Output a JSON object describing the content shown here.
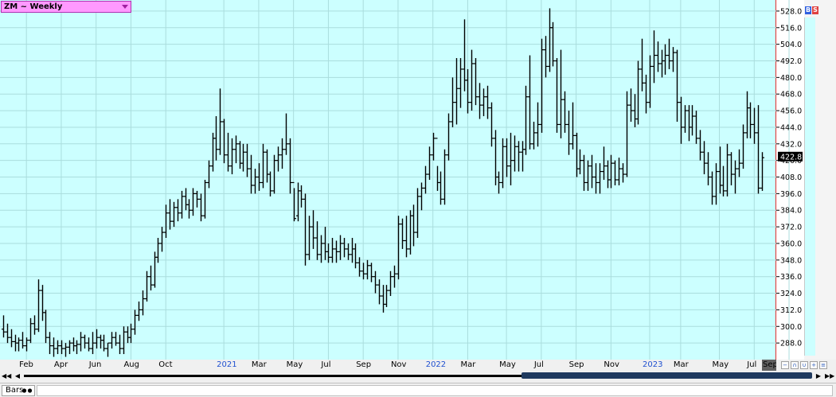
{
  "window": {
    "title": "ZM ~ Weekly",
    "bottom_tab": "Bars",
    "badges": [
      {
        "label": "B",
        "color": "#3060e0"
      },
      {
        "label": "S",
        "color": "#e04040"
      }
    ],
    "sep_label": "Sep"
  },
  "colors": {
    "plot_background": "#ccffff",
    "grid": "#aadddd",
    "bars": "#000000",
    "border": "#e03030",
    "year_label": "#2050d0",
    "title_background": "#ff99ff",
    "last_price_box": "#000000"
  },
  "chart_data": {
    "type": "ohlc",
    "title": "ZM ~ Weekly",
    "timeframe": "Weekly",
    "ylim": [
      276,
      536
    ],
    "y_ticks": [
      528,
      516,
      504,
      492,
      480,
      468,
      456,
      444,
      432,
      420,
      408,
      396,
      384,
      372,
      360,
      348,
      336,
      324,
      312,
      300,
      288
    ],
    "y_tick_labels": [
      "528.0",
      "516.0",
      "504.0",
      "492.0",
      "480.0",
      "468.0",
      "456.0",
      "444.0",
      "432.0",
      "420.0",
      "408.0",
      "396.0",
      "384.0",
      "372.0",
      "360.0",
      "348.0",
      "336.0",
      "324.0",
      "312.0",
      "300.0",
      "288.0"
    ],
    "last_price": 422.8,
    "last_price_label": "422.8",
    "x_labels": [
      {
        "label": "Feb",
        "bar": 6,
        "year": false
      },
      {
        "label": "Apr",
        "bar": 15,
        "year": false
      },
      {
        "label": "Jun",
        "bar": 24,
        "year": false
      },
      {
        "label": "Aug",
        "bar": 33,
        "year": false
      },
      {
        "label": "Oct",
        "bar": 42,
        "year": false
      },
      {
        "label": "2021",
        "bar": 57,
        "year": true
      },
      {
        "label": "Mar",
        "bar": 66,
        "year": false
      },
      {
        "label": "May",
        "bar": 75,
        "year": false
      },
      {
        "label": "Jul",
        "bar": 84,
        "year": false
      },
      {
        "label": "Sep",
        "bar": 93,
        "year": false
      },
      {
        "label": "Nov",
        "bar": 102,
        "year": false
      },
      {
        "label": "2022",
        "bar": 111,
        "year": true
      },
      {
        "label": "Mar",
        "bar": 120,
        "year": false
      },
      {
        "label": "May",
        "bar": 130,
        "year": false
      },
      {
        "label": "Jul",
        "bar": 139,
        "year": false
      },
      {
        "label": "Sep",
        "bar": 148,
        "year": false
      },
      {
        "label": "Nov",
        "bar": 157,
        "year": false
      },
      {
        "label": "2023",
        "bar": 167,
        "year": true
      },
      {
        "label": "Mar",
        "bar": 175,
        "year": false
      },
      {
        "label": "May",
        "bar": 185,
        "year": false
      },
      {
        "label": "Jul",
        "bar": 194,
        "year": false
      },
      {
        "label": "Sep",
        "bar": 203,
        "year": false
      }
    ],
    "ohlc": [
      [
        298,
        308,
        292,
        296
      ],
      [
        296,
        302,
        288,
        292
      ],
      [
        292,
        298,
        285,
        289
      ],
      [
        289,
        294,
        282,
        288
      ],
      [
        288,
        292,
        282,
        290
      ],
      [
        290,
        296,
        284,
        286
      ],
      [
        286,
        292,
        282,
        290
      ],
      [
        290,
        306,
        288,
        302
      ],
      [
        302,
        308,
        294,
        298
      ],
      [
        298,
        334,
        296,
        326
      ],
      [
        326,
        330,
        304,
        310
      ],
      [
        310,
        312,
        288,
        292
      ],
      [
        292,
        296,
        280,
        286
      ],
      [
        286,
        292,
        278,
        284
      ],
      [
        284,
        290,
        280,
        286
      ],
      [
        286,
        290,
        280,
        284
      ],
      [
        284,
        288,
        278,
        285
      ],
      [
        285,
        290,
        280,
        288
      ],
      [
        288,
        292,
        282,
        286
      ],
      [
        286,
        290,
        280,
        287
      ],
      [
        287,
        296,
        282,
        292
      ],
      [
        292,
        294,
        284,
        288
      ],
      [
        288,
        292,
        282,
        284
      ],
      [
        284,
        296,
        280,
        288
      ],
      [
        288,
        298,
        284,
        292
      ],
      [
        292,
        294,
        284,
        290
      ],
      [
        290,
        294,
        282,
        284
      ],
      [
        284,
        288,
        278,
        288
      ],
      [
        288,
        296,
        284,
        292
      ],
      [
        292,
        296,
        286,
        288
      ],
      [
        288,
        294,
        280,
        284
      ],
      [
        284,
        300,
        280,
        296
      ],
      [
        296,
        300,
        288,
        292
      ],
      [
        292,
        302,
        288,
        298
      ],
      [
        298,
        312,
        294,
        308
      ],
      [
        308,
        318,
        304,
        312
      ],
      [
        312,
        326,
        308,
        320
      ],
      [
        320,
        340,
        318,
        336
      ],
      [
        336,
        344,
        326,
        330
      ],
      [
        330,
        354,
        328,
        350
      ],
      [
        350,
        364,
        346,
        360
      ],
      [
        360,
        372,
        354,
        368
      ],
      [
        368,
        388,
        364,
        382
      ],
      [
        382,
        392,
        370,
        376
      ],
      [
        376,
        390,
        372,
        386
      ],
      [
        386,
        392,
        376,
        382
      ],
      [
        382,
        398,
        378,
        394
      ],
      [
        394,
        400,
        384,
        388
      ],
      [
        388,
        392,
        378,
        384
      ],
      [
        384,
        400,
        380,
        396
      ],
      [
        396,
        398,
        386,
        392
      ],
      [
        392,
        396,
        376,
        380
      ],
      [
        380,
        406,
        378,
        404
      ],
      [
        404,
        420,
        400,
        416
      ],
      [
        416,
        440,
        412,
        436
      ],
      [
        436,
        452,
        420,
        428
      ],
      [
        428,
        472,
        424,
        448
      ],
      [
        448,
        450,
        418,
        424
      ],
      [
        424,
        440,
        412,
        416
      ],
      [
        416,
        436,
        410,
        428
      ],
      [
        428,
        438,
        418,
        432
      ],
      [
        432,
        434,
        414,
        418
      ],
      [
        418,
        432,
        412,
        426
      ],
      [
        426,
        432,
        408,
        414
      ],
      [
        414,
        424,
        396,
        402
      ],
      [
        402,
        414,
        396,
        408
      ],
      [
        408,
        418,
        398,
        404
      ],
      [
        404,
        432,
        400,
        426
      ],
      [
        426,
        428,
        404,
        410
      ],
      [
        410,
        412,
        394,
        398
      ],
      [
        398,
        424,
        396,
        420
      ],
      [
        420,
        430,
        412,
        424
      ],
      [
        424,
        436,
        414,
        428
      ],
      [
        428,
        454,
        424,
        432
      ],
      [
        432,
        436,
        396,
        404
      ],
      [
        404,
        400,
        376,
        378
      ],
      [
        380,
        404,
        376,
        398
      ],
      [
        398,
        402,
        386,
        392
      ],
      [
        392,
        396,
        344,
        352
      ],
      [
        352,
        380,
        348,
        372
      ],
      [
        372,
        384,
        356,
        364
      ],
      [
        364,
        376,
        348,
        352
      ],
      [
        352,
        366,
        346,
        360
      ],
      [
        360,
        372,
        348,
        354
      ],
      [
        354,
        360,
        346,
        350
      ],
      [
        350,
        364,
        346,
        356
      ],
      [
        356,
        362,
        346,
        354
      ],
      [
        354,
        366,
        348,
        360
      ],
      [
        360,
        364,
        350,
        356
      ],
      [
        356,
        360,
        348,
        352
      ],
      [
        352,
        364,
        346,
        356
      ],
      [
        356,
        360,
        342,
        346
      ],
      [
        346,
        350,
        336,
        340
      ],
      [
        340,
        346,
        334,
        338
      ],
      [
        338,
        348,
        334,
        344
      ],
      [
        344,
        346,
        332,
        336
      ],
      [
        336,
        340,
        324,
        330
      ],
      [
        330,
        334,
        316,
        322
      ],
      [
        322,
        330,
        310,
        316
      ],
      [
        316,
        330,
        314,
        326
      ],
      [
        326,
        340,
        322,
        336
      ],
      [
        336,
        344,
        328,
        338
      ],
      [
        338,
        380,
        334,
        374
      ],
      [
        374,
        378,
        356,
        362
      ],
      [
        362,
        380,
        350,
        356
      ],
      [
        356,
        384,
        352,
        380
      ],
      [
        380,
        388,
        358,
        368
      ],
      [
        368,
        400,
        364,
        394
      ],
      [
        394,
        404,
        384,
        400
      ],
      [
        400,
        416,
        396,
        410
      ],
      [
        410,
        430,
        406,
        424
      ],
      [
        424,
        440,
        420,
        436
      ],
      [
        436,
        416,
        398,
        404
      ],
      [
        404,
        412,
        388,
        392
      ],
      [
        392,
        428,
        388,
        424
      ],
      [
        424,
        454,
        420,
        448
      ],
      [
        448,
        480,
        444,
        462
      ],
      [
        462,
        494,
        446,
        472
      ],
      [
        472,
        494,
        458,
        486
      ],
      [
        486,
        522,
        470,
        478
      ],
      [
        478,
        486,
        454,
        462
      ],
      [
        462,
        500,
        456,
        490
      ],
      [
        490,
        494,
        460,
        466
      ],
      [
        466,
        476,
        450,
        460
      ],
      [
        460,
        472,
        452,
        466
      ],
      [
        466,
        474,
        450,
        458
      ],
      [
        458,
        462,
        430,
        436
      ],
      [
        436,
        442,
        402,
        408
      ],
      [
        408,
        412,
        396,
        404
      ],
      [
        404,
        436,
        400,
        430
      ],
      [
        430,
        436,
        408,
        416
      ],
      [
        416,
        440,
        402,
        420
      ],
      [
        420,
        438,
        412,
        430
      ],
      [
        430,
        434,
        412,
        426
      ],
      [
        426,
        434,
        412,
        428
      ],
      [
        428,
        474,
        424,
        466
      ],
      [
        466,
        496,
        428,
        432
      ],
      [
        432,
        448,
        428,
        440
      ],
      [
        440,
        462,
        430,
        446
      ],
      [
        446,
        508,
        440,
        500
      ],
      [
        500,
        510,
        480,
        488
      ],
      [
        488,
        530,
        484,
        516
      ],
      [
        516,
        520,
        488,
        492
      ],
      [
        492,
        494,
        440,
        446
      ],
      [
        446,
        500,
        436,
        464
      ],
      [
        464,
        470,
        440,
        446
      ],
      [
        446,
        456,
        424,
        432
      ],
      [
        432,
        462,
        428,
        438
      ],
      [
        438,
        440,
        408,
        414
      ],
      [
        414,
        428,
        410,
        420
      ],
      [
        420,
        424,
        398,
        404
      ],
      [
        404,
        420,
        398,
        416
      ],
      [
        416,
        424,
        400,
        408
      ],
      [
        408,
        418,
        396,
        404
      ],
      [
        404,
        418,
        396,
        412
      ],
      [
        412,
        430,
        406,
        416
      ],
      [
        416,
        420,
        400,
        406
      ],
      [
        406,
        424,
        400,
        418
      ],
      [
        418,
        420,
        402,
        406
      ],
      [
        406,
        422,
        402,
        414
      ],
      [
        414,
        418,
        404,
        410
      ],
      [
        410,
        470,
        408,
        460
      ],
      [
        460,
        472,
        448,
        456
      ],
      [
        456,
        468,
        444,
        450
      ],
      [
        450,
        492,
        446,
        486
      ],
      [
        486,
        508,
        470,
        476
      ],
      [
        476,
        482,
        454,
        462
      ],
      [
        462,
        496,
        458,
        488
      ],
      [
        488,
        514,
        476,
        496
      ],
      [
        496,
        506,
        484,
        490
      ],
      [
        490,
        500,
        480,
        492
      ],
      [
        492,
        504,
        482,
        496
      ],
      [
        496,
        508,
        486,
        492
      ],
      [
        492,
        502,
        484,
        498
      ],
      [
        498,
        500,
        448,
        462
      ],
      [
        462,
        466,
        432,
        444
      ],
      [
        444,
        460,
        440,
        456
      ],
      [
        456,
        460,
        434,
        444
      ],
      [
        444,
        460,
        438,
        452
      ],
      [
        452,
        456,
        432,
        436
      ],
      [
        436,
        442,
        420,
        426
      ],
      [
        426,
        434,
        410,
        418
      ],
      [
        418,
        426,
        402,
        408
      ],
      [
        408,
        412,
        388,
        394
      ],
      [
        394,
        418,
        388,
        412
      ],
      [
        412,
        430,
        396,
        402
      ],
      [
        402,
        416,
        394,
        398
      ],
      [
        398,
        432,
        394,
        424
      ],
      [
        424,
        426,
        402,
        410
      ],
      [
        410,
        420,
        396,
        414
      ],
      [
        414,
        428,
        408,
        418
      ],
      [
        418,
        446,
        414,
        440
      ],
      [
        440,
        470,
        436,
        458
      ],
      [
        458,
        462,
        436,
        446
      ],
      [
        446,
        458,
        432,
        440
      ],
      [
        440,
        460,
        396,
        400
      ],
      [
        400,
        426,
        398,
        422
      ]
    ]
  }
}
